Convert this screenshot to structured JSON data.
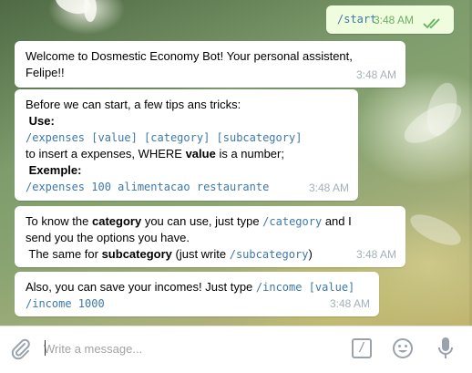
{
  "chat": {
    "outgoing": {
      "text": "/start",
      "time": "3:48 AM",
      "status": "read"
    },
    "msg1": {
      "line1": "Welcome to Dosmestic Economy Bot! Your personal assistent,",
      "line2": "Felipe!!",
      "time": "3:48 AM"
    },
    "msg2": {
      "intro": "Before we can start, a few tips ans tricks:",
      "use_label": "Use:",
      "use_cmd": "/expenses [value] [category] [subcategory]",
      "insert_pre": "to insert a expenses, WHERE ",
      "insert_bold": "value",
      "insert_post": " is a number;",
      "example_label": "Exemple:",
      "example_cmd": "/expenses 100 alimentacao restaurante",
      "time": "3:48 AM"
    },
    "msg3": {
      "l1_pre": "To know the ",
      "l1_bold": "category",
      "l1_mid": " you can use, just type ",
      "l1_cmd": "/category",
      "l1_post": " and I",
      "l2": "send you the options you have.",
      "l3_pre": " The same for ",
      "l3_bold": "subcategory",
      "l3_mid": " (just write ",
      "l3_cmd": "/subcategory",
      "l3_post": ")",
      "time": "3:48 AM"
    },
    "msg4": {
      "l1_pre": "Also, you can save your incomes! Just type ",
      "l1_cmd": "/income [value]",
      "l2_cmd": "/income 1000",
      "time": "3:48 AM"
    }
  },
  "composer": {
    "placeholder": "Write a message...",
    "commands_button": "/",
    "attach_icon": "paperclip-icon",
    "emoji_icon": "smiley-icon",
    "mic_icon": "microphone-icon"
  },
  "colors": {
    "outgoing_bubble": "#effdde",
    "incoming_bubble": "#ffffff",
    "command_link": "#3e78a8",
    "timestamp": "#a4b1b8",
    "outgoing_time": "#6cae68"
  }
}
